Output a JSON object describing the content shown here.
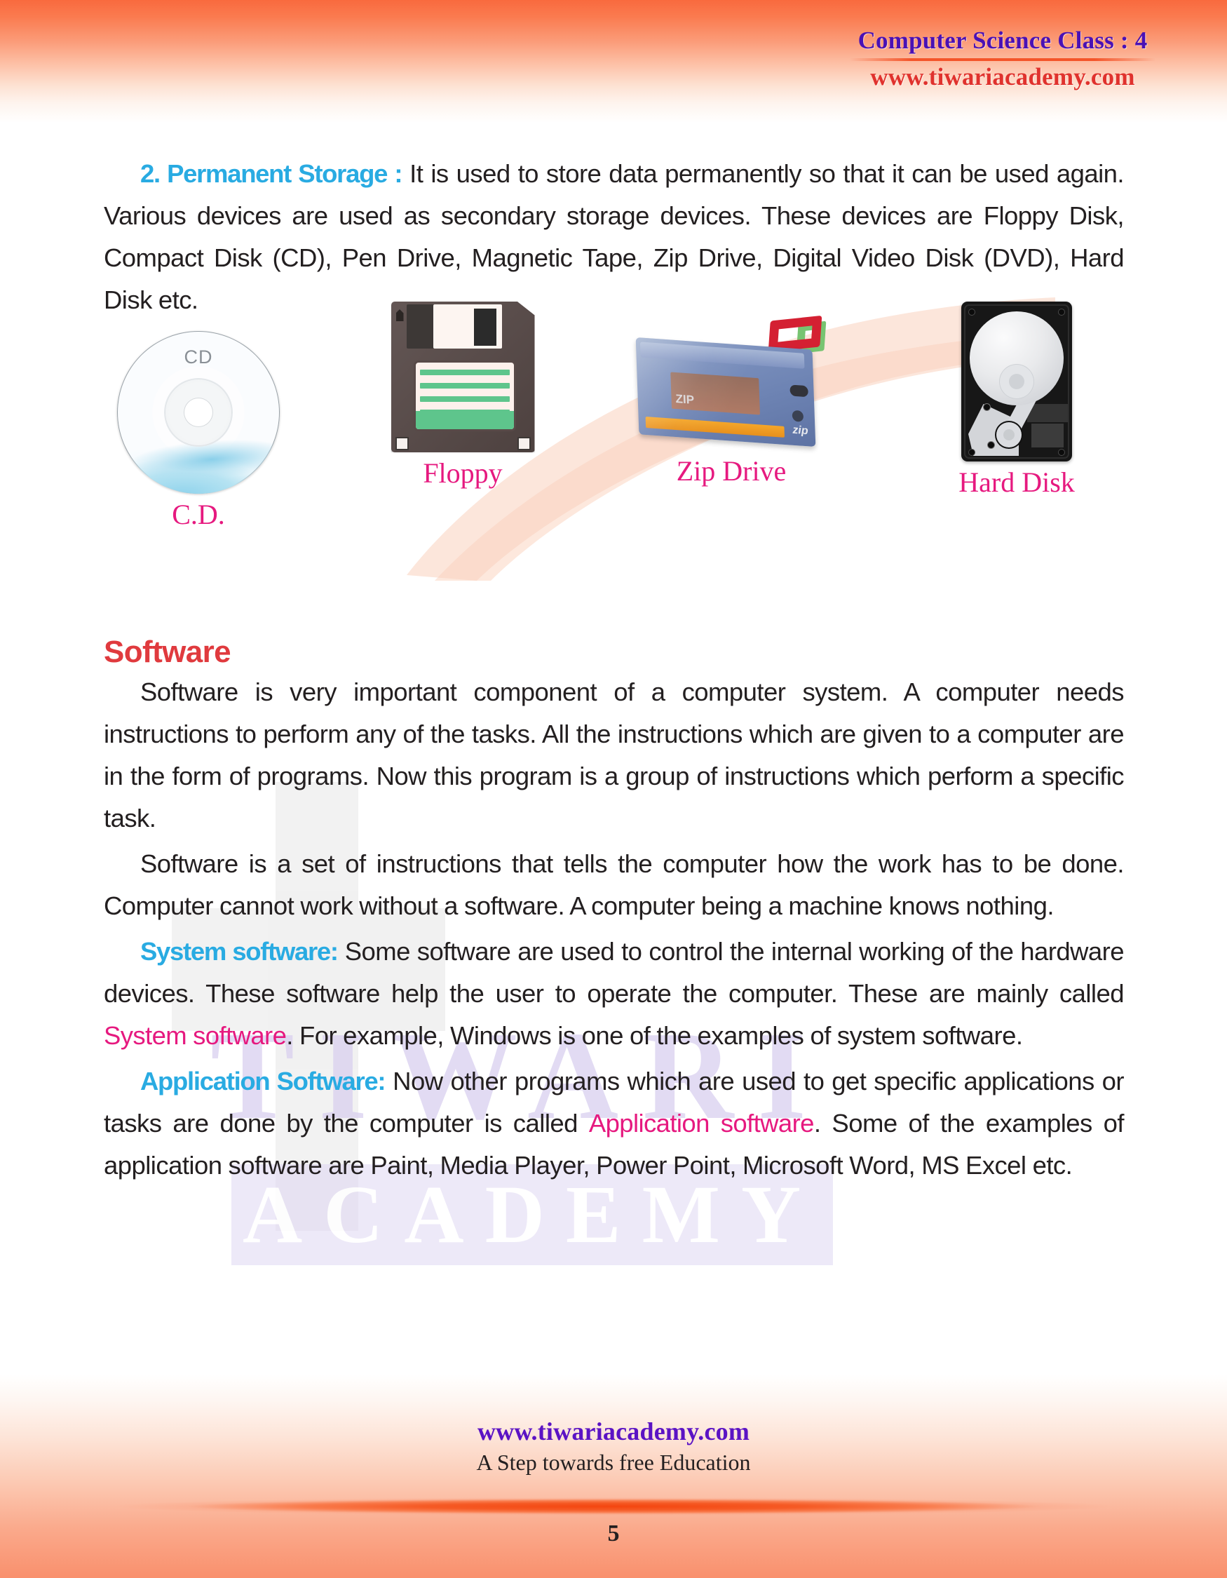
{
  "header": {
    "title": "Computer Science Class : 4",
    "url": "www.tiwariacademy.com"
  },
  "watermark": {
    "word1": "TIWARI",
    "word2": "ACADEMY"
  },
  "content": {
    "permanent_storage": {
      "label": "2. Permanent Storage :",
      "text": " It is used to store data permanently so that it can be used again. Various devices are used as secondary storage devices. These devices are Floppy Disk, Compact Disk (CD), Pen Drive, Magnetic Tape, Zip Drive, Digital Video Disk (DVD), Hard Disk etc."
    },
    "software_heading": "Software",
    "para_1": "Software is very important component of a computer system. A computer needs instructions to perform any of the tasks. All the instructions which are given to a computer are in the form of programs. Now this program is a group of instructions which perform a specific task.",
    "para_2": "Software  is a set of instructions that tells the computer how the work has to be done. Computer cannot work without a software. A computer being a machine knows nothing.",
    "system_software": {
      "label": "System software:",
      "text_before": " Some software are used to control the internal working of the hardware devices. These software help the user to operate the computer. These are mainly called ",
      "emphasis": "System software",
      "text_after": ". For example, Windows is one of the examples of system software."
    },
    "application_software": {
      "label": "Application Software:",
      "text_before": " Now other programs which are used to get specific applications or tasks are done by the computer is called ",
      "emphasis": "Application software",
      "text_after": ". Some of the examples of application software are Paint, Media Player, Power Point, Microsoft Word, MS Excel etc."
    }
  },
  "figures": [
    {
      "caption": "C.D.",
      "icon": "cd-disc-icon",
      "disc_label": "CD"
    },
    {
      "caption": "Floppy",
      "icon": "floppy-disk-icon"
    },
    {
      "caption": "Zip Drive",
      "icon": "zip-drive-icon",
      "cartridge_label": "ZIP",
      "brand_label": "zip"
    },
    {
      "caption": "Hard Disk",
      "icon": "hard-disk-icon"
    }
  ],
  "footer": {
    "url": "www.tiwariacademy.com",
    "tagline": "A Step towards free Education",
    "page_number": "5"
  },
  "colors": {
    "accent_orange": "#f96a3e",
    "heading_red": "#e03a3e",
    "label_blue": "#29abe2",
    "emphasis_pink": "#e6197f",
    "header_purple": "#4a11b5",
    "header_red": "#e0322d",
    "footer_purple": "#5b13c4",
    "body_text": "#231f20"
  }
}
